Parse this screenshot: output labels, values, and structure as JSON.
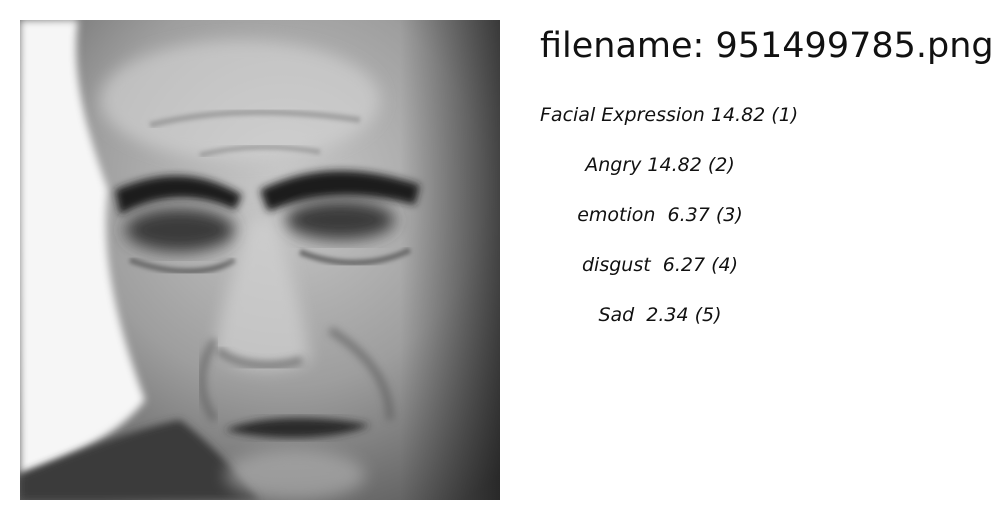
{
  "header": {
    "filename_label": "filename: 951499785.png"
  },
  "image": {
    "icon": "grayscale-face-photo"
  },
  "predictions": [
    {
      "text": "Facial Expression 14.82 (1)"
    },
    {
      "text": "Angry 14.82 (2)"
    },
    {
      "text": "emotion  6.37 (3)"
    },
    {
      "text": "disgust  6.27 (4)"
    },
    {
      "text": "Sad  2.34 (5)"
    }
  ]
}
